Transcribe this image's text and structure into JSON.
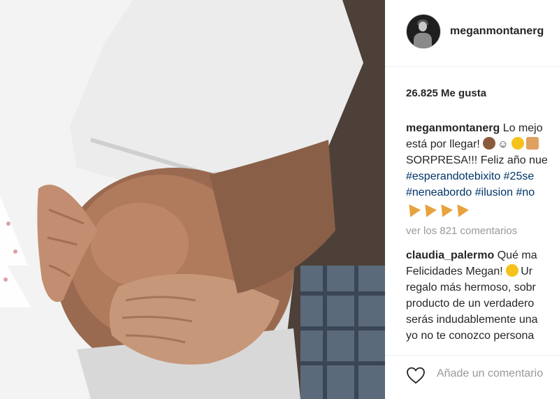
{
  "post": {
    "username": "meganmontanerg",
    "likes": "26.825 Me gusta",
    "caption_lines": [
      "Lo mejo",
      "está por llegar!",
      "SORPRESA!!! Feliz año nue",
      "#esperandotebixito #25se",
      "#neneabordo #ilusion #no"
    ],
    "view_all_comments": "ver los 821 comentarios",
    "comment": {
      "username": "claudia_palermo",
      "lines": [
        "Qué ma",
        "Felicidades Megan!",
        "regalo más hermoso, sobr",
        "producto de un verdadero",
        "serás indudablemente una",
        "yo no te conozco persona"
      ],
      "tail": "Ur"
    },
    "add_comment_placeholder": "Añade un comentario",
    "icons": [
      "like-heart-icon",
      "monkey-emoji-icon",
      "smile-emoji-icon",
      "blush-emoji-icon",
      "couple-emoji-icon",
      "party-popper-emoji-icon"
    ]
  }
}
